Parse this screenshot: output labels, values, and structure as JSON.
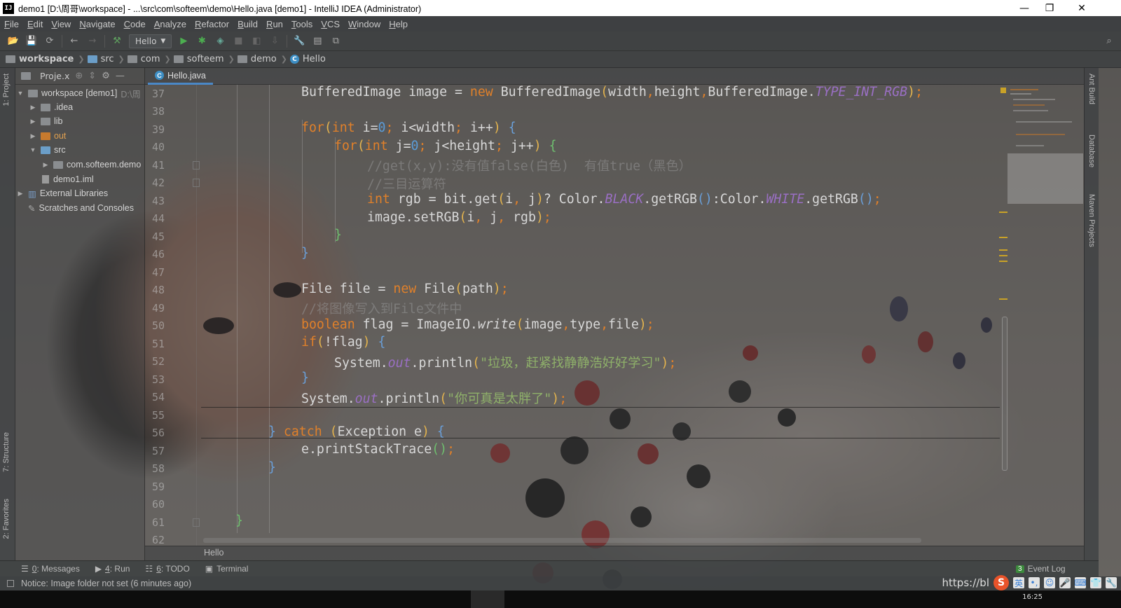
{
  "window": {
    "title": "demo1 [D:\\周哥\\workspace] - ...\\src\\com\\softeem\\demo\\Hello.java [demo1] - IntelliJ IDEA (Administrator)",
    "logo_text": "IJ",
    "minimize": "—",
    "maximize": "❐",
    "close": "✕"
  },
  "menu": [
    "File",
    "Edit",
    "View",
    "Navigate",
    "Code",
    "Analyze",
    "Refactor",
    "Build",
    "Run",
    "Tools",
    "VCS",
    "Window",
    "Help"
  ],
  "toolbar": {
    "run_config": "Hello",
    "icons": [
      "open-folder-icon",
      "save-icon",
      "sync-icon",
      "back-arrow-icon",
      "forward-arrow-icon",
      "build-hammer-icon",
      "run-icon",
      "debug-icon",
      "coverage-icon",
      "stop-icon",
      "settings-wrench-icon",
      "project-structure-icon",
      "search-icon"
    ]
  },
  "breadcrumb": [
    "workspace",
    "src",
    "com",
    "softeem",
    "demo",
    "Hello"
  ],
  "left_stripe": {
    "project": "1: Project",
    "structure": "7: Structure",
    "favorites": "2: Favorites"
  },
  "project_panel": {
    "header": "Proje.x",
    "tree": [
      {
        "label": "workspace [demo1]",
        "extra": "D:\\周",
        "level": 0,
        "expanded": true,
        "kind": "module"
      },
      {
        "label": ".idea",
        "level": 1,
        "expanded": false,
        "kind": "folder"
      },
      {
        "label": "lib",
        "level": 1,
        "expanded": false,
        "kind": "folder"
      },
      {
        "label": "out",
        "level": 1,
        "expanded": false,
        "kind": "folder-orange"
      },
      {
        "label": "src",
        "level": 1,
        "expanded": true,
        "kind": "folder-blue"
      },
      {
        "label": "com.softeem.demo",
        "level": 2,
        "expanded": false,
        "kind": "package"
      },
      {
        "label": "demo1.iml",
        "level": 1,
        "kind": "file"
      },
      {
        "label": "External Libraries",
        "level": 0,
        "expanded": false,
        "kind": "libraries"
      },
      {
        "label": "Scratches and Consoles",
        "level": 0,
        "kind": "scratches"
      }
    ]
  },
  "editor": {
    "tab": "Hello.java",
    "footer": "Hello",
    "line_numbers": [
      "37",
      "38",
      "39",
      "40",
      "41",
      "42",
      "43",
      "44",
      "45",
      "46",
      "47",
      "48",
      "49",
      "50",
      "51",
      "52",
      "53",
      "54",
      "55",
      "56",
      "57",
      "58",
      "59",
      "60",
      "61",
      "62"
    ]
  },
  "right_stripe": {
    "ant": "Ant Build",
    "database": "Database",
    "maven": "Maven Projects"
  },
  "bottom_tabs": [
    {
      "num": "0",
      "label": ": Messages"
    },
    {
      "num": "4",
      "label": ": Run"
    },
    {
      "num": "6",
      "label": ": TODO"
    },
    {
      "num": "",
      "label": "Terminal"
    }
  ],
  "event_log": {
    "count": "3",
    "label": "Event Log"
  },
  "status": {
    "message": "Notice: Image folder not set (6 minutes ago)"
  },
  "tray": {
    "url_fragment": "https://bl",
    "ime": "英",
    "time": "16:25"
  },
  "colors": {
    "keyword": "#e0802a",
    "number": "#5b9bd6",
    "static_field": "#9a6fc4",
    "string": "#8fb16a",
    "accent_tab": "#4a88c7"
  }
}
